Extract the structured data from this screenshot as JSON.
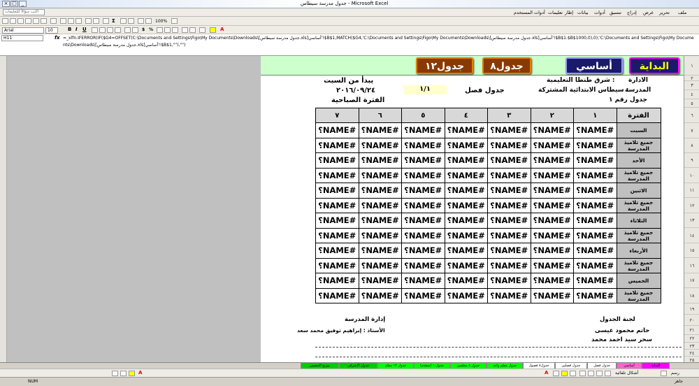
{
  "window": {
    "title": "جدول مدرسة سيطاس - Microsoft Excel",
    "controls": [
      "_",
      "□",
      "×"
    ]
  },
  "menu": {
    "help_placeholder": "اكتب سؤالاً للتعليمات",
    "items": [
      "ملف",
      "تحرير",
      "عرض",
      "إدراج",
      "تنسيق",
      "أدوات",
      "بيانات",
      "إطار",
      "تعليمات",
      "أدوات المستخدم"
    ]
  },
  "toolbar": {
    "font": "Arial",
    "size": "10",
    "zoom": "100%"
  },
  "formula": {
    "name_box": "H11",
    "fx": "fx",
    "text": "=_xlfn.IFERROR(IF($G4=OFFSET(C:\\Documents and Settings\\Figo\\My Documents\\Downloads\\[جدول مدرسة سيطاس.xls]أساسي'!$B$1,MATCH($G4,'C:\\Documents and Settings\\Figo\\My Documents\\Downloads\\[جدول مدرسة سيطاس.xls]أساسي'!$B$1:$B$1000,0),0);'C:\\Documents and Settings\\Figo\\My Documents\\Downloads\\[جدول مدرسة سيطاس.xls]أساسي'!$B$1,\"\"),\"\")"
  },
  "nav": {
    "start": "البداية",
    "basic": "أساسي",
    "table8": "جدول٨",
    "table12": "جدول١٢"
  },
  "header": {
    "admin_label": "الادارة",
    "admin_value": ": شرق طنطا التعليمية",
    "school_label": "المدرسة",
    "school_value": ": سيطاس الابتدائية المشتركة",
    "table_no": "جدول رقم  ١",
    "class_label": "جدول فصل",
    "class_value": "١/١",
    "start_label": "يبدأ من السبت",
    "date": "٢٠١٦/٠٩/٢٤",
    "shift": "الفترة الصباحية"
  },
  "grid": {
    "period_header": "الفترة",
    "periods": [
      "١",
      "٢",
      "٣",
      "٤",
      "٥",
      "٦",
      "٧"
    ],
    "error": "#NAME؟",
    "days": [
      {
        "day": "السبت",
        "sub": "جميع تلاميذ المدرسة"
      },
      {
        "day": "الأحد",
        "sub": "جميع تلاميذ المدرسة"
      },
      {
        "day": "الاثنين",
        "sub": "جميع تلاميذ المدرسة"
      },
      {
        "day": "الثلاثاء",
        "sub": "جميع تلاميذ المدرسة"
      },
      {
        "day": "الأربعاء",
        "sub": "جميع تلاميذ المدرسة"
      },
      {
        "day": "الخميس",
        "sub": "جميع تلاميذ المدرسة"
      }
    ]
  },
  "footer": {
    "committee": "لجنة الجدول",
    "member1": "حاتم محمود عيسى",
    "member2": "سحر سيد احمد محمد",
    "management": "إدارة المدرسة",
    "teacher": "الأستاذ : إبراهيم توفيق محمد سعد"
  },
  "rows": [
    "١",
    "٢",
    "٣",
    "٤",
    "٥",
    "٦",
    "٧",
    "٨",
    "٩",
    "١٠",
    "١١",
    "١٢",
    "١٣",
    "١٤",
    "١٥",
    "١٦",
    "١٧",
    "١٨",
    "١٩",
    "٢٠",
    "٢١",
    "٢٢",
    "٢٣",
    "٢٤",
    "٢٥",
    "٢٦",
    "٢٧",
    "٢٨"
  ],
  "tabs": [
    {
      "label": "البداية",
      "color": "#ff00ff"
    },
    {
      "label": "أساسي",
      "color": "#ff66cc"
    },
    {
      "label": "جدول فصل",
      "color": "#ffffff"
    },
    {
      "label": "جدول فصلين",
      "color": "#ffffff"
    },
    {
      "label": "جدول٨ فصول",
      "color": "#ffffff"
    },
    {
      "label": "جدول معلم واحد",
      "color": "#00ff00"
    },
    {
      "label": "جدول ٨ معلمين",
      "color": "#00ff00"
    },
    {
      "label": "جدول ١ (متقدم)",
      "color": "#00ff00"
    },
    {
      "label": "جدول ١٢ معلم",
      "color": "#00ff00"
    },
    {
      "label": "جدول الاشراف",
      "color": "#00cc00"
    },
    {
      "label": "توزيع الحصص",
      "color": "#00cc00"
    }
  ],
  "drawbar": {
    "draw": "رسم",
    "autoshapes": "أشكال تلقائية"
  },
  "status": {
    "left": "جاهز",
    "right": "NUM"
  }
}
